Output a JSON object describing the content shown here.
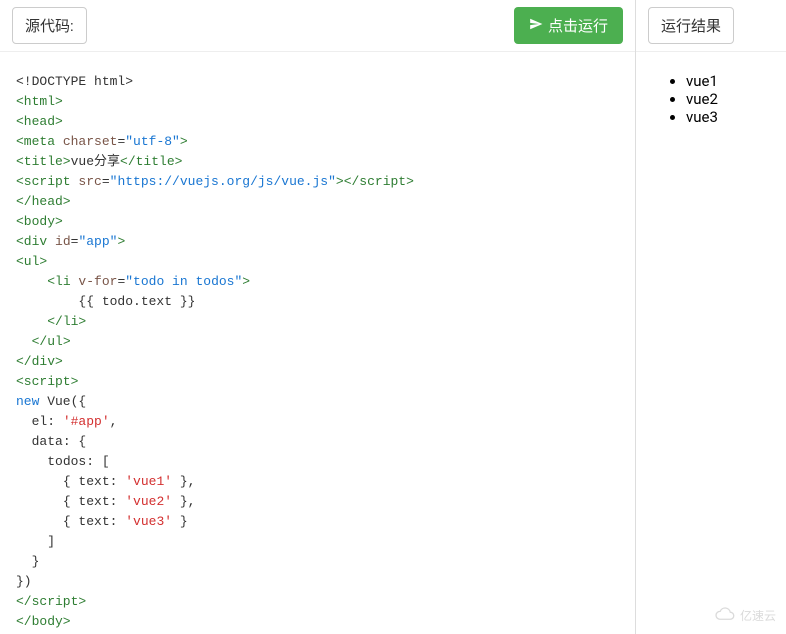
{
  "toolbar": {
    "source_label": "源代码:",
    "run_label": "点击运行"
  },
  "result": {
    "header": "运行结果",
    "items": [
      "vue1",
      "vue2",
      "vue3"
    ]
  },
  "footer": {
    "watermark": "亿速云"
  },
  "code": {
    "lines": [
      {
        "t": "doc",
        "v": "<!DOCTYPE html>"
      },
      {
        "t": "tag",
        "v": "<html>"
      },
      {
        "t": "tag",
        "v": "<head>"
      },
      {
        "t": "meta",
        "tag": "<meta",
        "attr": " charset",
        "eq": "=",
        "str": "\"utf-8\"",
        "end": ">"
      },
      {
        "t": "title",
        "open": "<title>",
        "text": "vue分享",
        "close": "</title>"
      },
      {
        "t": "script",
        "open": "<script",
        "attr": " src",
        "eq": "=",
        "str": "\"https://vuejs.org/js/vue.js\"",
        "mid": ">",
        "close": "</script>"
      },
      {
        "t": "tag",
        "v": "</head>"
      },
      {
        "t": "tag",
        "v": "<body>"
      },
      {
        "t": "div",
        "open": "<div",
        "attr": " id",
        "eq": "=",
        "str": "\"app\"",
        "end": ">"
      },
      {
        "t": "tag",
        "v": "<ul>"
      },
      {
        "t": "li",
        "indent": "    ",
        "open": "<li",
        "attr": " v-for",
        "eq": "=",
        "str": "\"todo in todos\"",
        "end": ">"
      },
      {
        "t": "plain",
        "indent": "        ",
        "v": "{{ todo.text }}"
      },
      {
        "t": "tagind",
        "indent": "    ",
        "v": "</li>"
      },
      {
        "t": "tagind",
        "indent": "  ",
        "v": "</ul>"
      },
      {
        "t": "tag",
        "v": "</div>"
      },
      {
        "t": "tag",
        "v": "<script>"
      },
      {
        "t": "new",
        "kw": "new",
        "rest": " Vue({"
      },
      {
        "t": "plain",
        "indent": "  ",
        "v": "el: ",
        "val": "'#app'",
        "after": ","
      },
      {
        "t": "plain",
        "indent": "  ",
        "v": "data: {"
      },
      {
        "t": "plain",
        "indent": "    ",
        "v": "todos: ["
      },
      {
        "t": "plain",
        "indent": "      ",
        "v": "{ text: ",
        "val": "'vue1'",
        "after": " },"
      },
      {
        "t": "plain",
        "indent": "      ",
        "v": "{ text: ",
        "val": "'vue2'",
        "after": " },"
      },
      {
        "t": "plain",
        "indent": "      ",
        "v": "{ text: ",
        "val": "'vue3'",
        "after": " }"
      },
      {
        "t": "plain",
        "indent": "    ",
        "v": "]"
      },
      {
        "t": "plain",
        "indent": "  ",
        "v": "}"
      },
      {
        "t": "plain",
        "indent": "",
        "v": "})"
      },
      {
        "t": "tag",
        "v": "</script>"
      },
      {
        "t": "tag",
        "v": "</body>"
      }
    ]
  }
}
